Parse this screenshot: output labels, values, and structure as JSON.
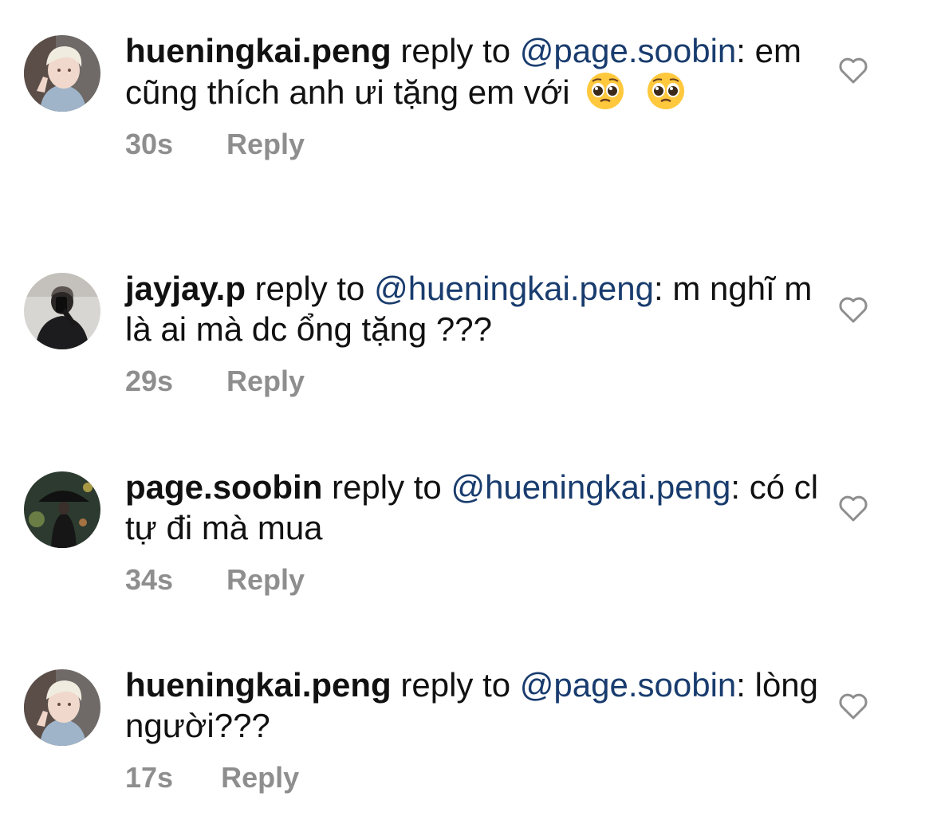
{
  "comments": [
    {
      "username": "hueningkai.peng",
      "reply_label": "reply to",
      "mention": "@page.soobin",
      "text": ": em cũng thích anh ưi tặng em với",
      "emoji": [
        "pleading-face",
        "pleading-face"
      ],
      "time": "30s",
      "reply_button": "Reply",
      "avatar": "blonde-selfie"
    },
    {
      "username": "jayjay.p",
      "reply_label": "reply to",
      "mention": "@hueningkai.peng",
      "text": ": m nghĩ m là ai mà dc ổng tặng ???",
      "time": "29s",
      "reply_button": "Reply",
      "avatar": "dark-mirror-selfie"
    },
    {
      "username": "page.soobin",
      "reply_label": "reply to",
      "mention": "@hueningkai.peng",
      "text": ": có cl tự đi mà mua",
      "time": "34s",
      "reply_button": "Reply",
      "avatar": "umbrella-night"
    },
    {
      "username": "hueningkai.peng",
      "reply_label": "reply to",
      "mention": "@page.soobin",
      "text": ": lòng người???",
      "time": "17s",
      "reply_button": "Reply",
      "avatar": "blonde-selfie"
    }
  ],
  "colors": {
    "mention": "#193c6e",
    "meta": "#8e8e8e",
    "text": "#111111"
  }
}
